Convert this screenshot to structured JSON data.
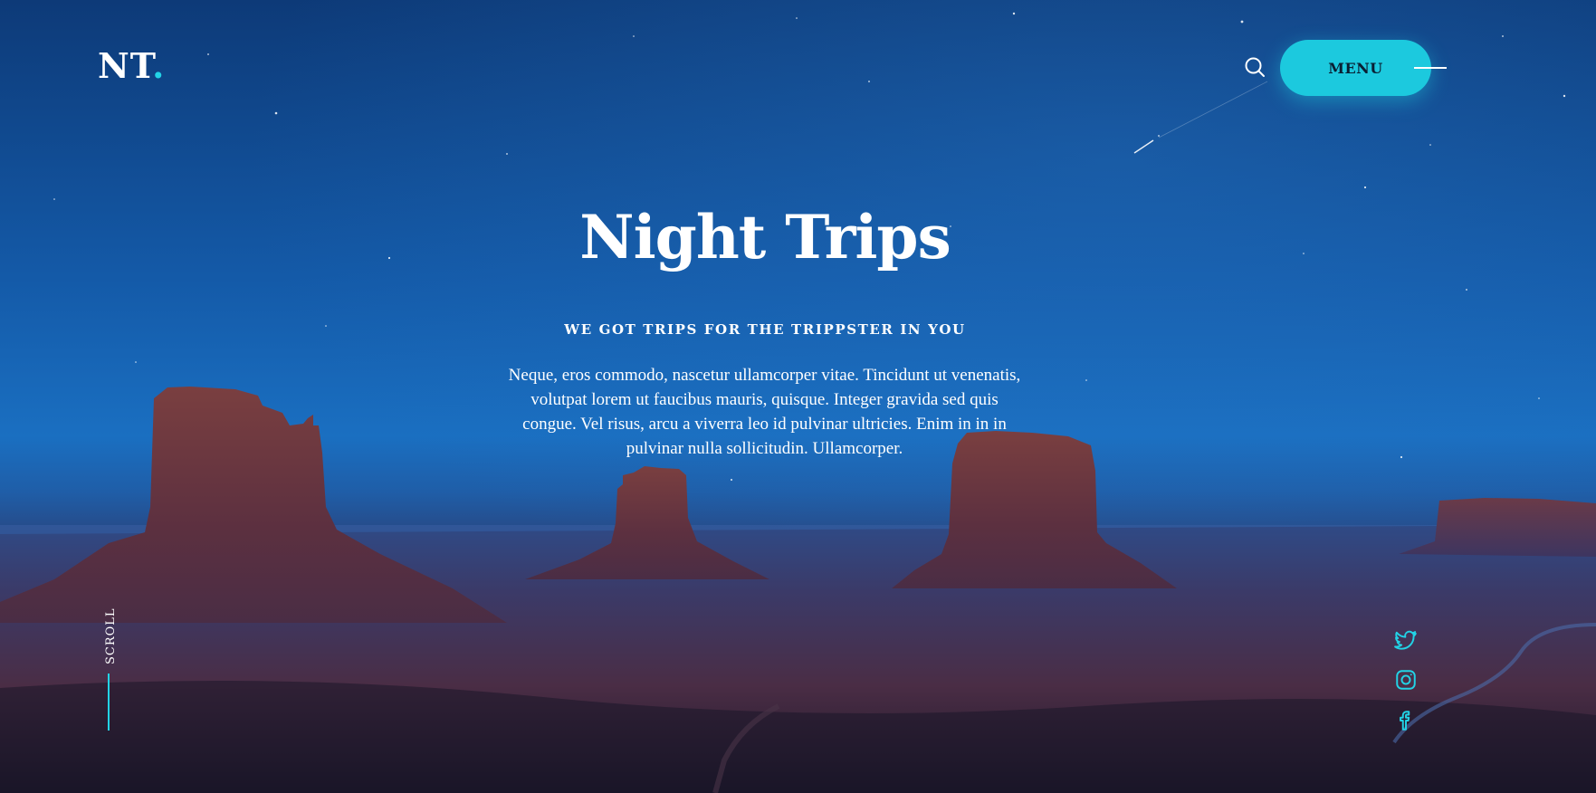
{
  "header": {
    "logo_text": "NT",
    "logo_dot": ".",
    "search_icon": "search-icon",
    "menu_label": "MENU",
    "menu_icon": "menu-line-icon"
  },
  "hero": {
    "title": "Night Trips",
    "subtitle": "WE GOT TRIPS FOR THE TRIPPSTER IN YOU",
    "body": "Neque, eros commodo, nascetur ullamcorper vitae. Tincidunt ut venenatis, volutpat lorem ut faucibus mauris, quisque. Integer gravida sed quis congue. Vel risus, arcu a viverra leo id pulvinar ultricies. Enim in in in pulvinar nulla sollicitudin. Ullamcorper."
  },
  "scroll": {
    "label": "SCROLL"
  },
  "social": [
    {
      "name": "twitter",
      "icon": "twitter-icon"
    },
    {
      "name": "instagram",
      "icon": "instagram-icon"
    },
    {
      "name": "facebook",
      "icon": "facebook-icon"
    }
  ],
  "colors": {
    "accent": "#1cc9de",
    "sky_top": "#0d3a78",
    "sky_mid": "#1a6fc1",
    "rock": "#6e3a3c",
    "ground_dark": "#1b1b34"
  }
}
